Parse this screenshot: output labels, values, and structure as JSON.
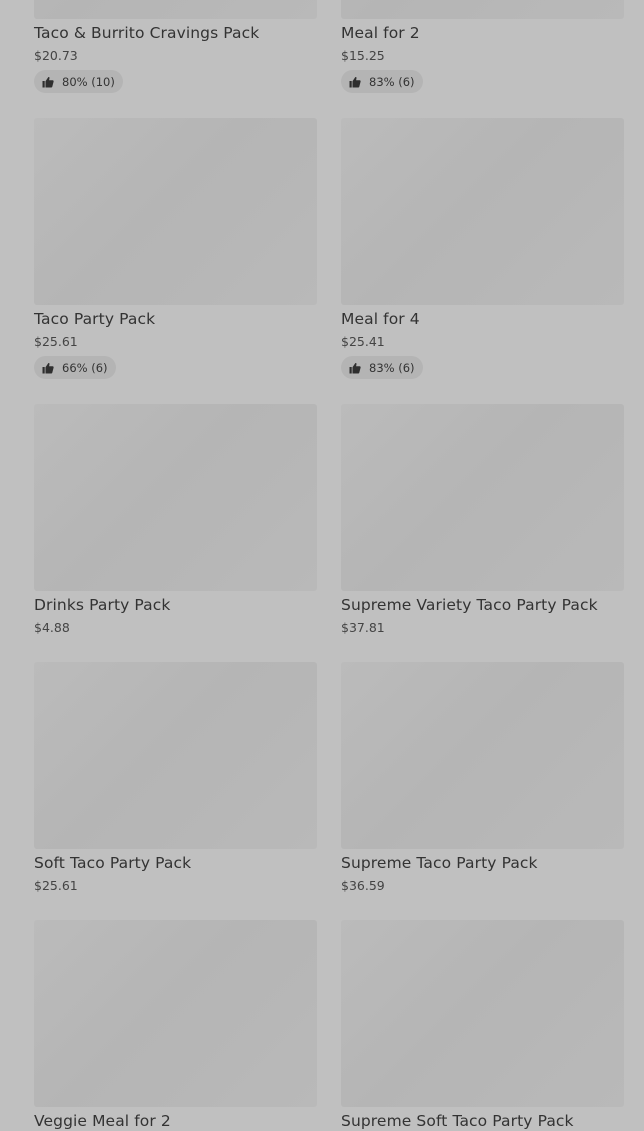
{
  "products": [
    {
      "name": "Taco & Burrito Cravings Pack",
      "price": "$20.73",
      "rating": "80% (10)"
    },
    {
      "name": "Meal for 2",
      "price": "$15.25",
      "rating": "83% (6)"
    },
    {
      "name": "Taco Party Pack",
      "price": "$25.61",
      "rating": "66% (6)"
    },
    {
      "name": "Meal for 4",
      "price": "$25.41",
      "rating": "83% (6)"
    },
    {
      "name": "Drinks Party Pack",
      "price": "$4.88",
      "rating": ""
    },
    {
      "name": "Supreme Variety Taco Party Pack",
      "price": "$37.81",
      "rating": ""
    },
    {
      "name": "Soft Taco Party Pack",
      "price": "$25.61",
      "rating": ""
    },
    {
      "name": "Supreme Taco Party Pack",
      "price": "$36.59",
      "rating": ""
    },
    {
      "name": "Veggie Meal for 2",
      "price": "",
      "rating": ""
    },
    {
      "name": "Supreme Soft Taco Party Pack",
      "price": "",
      "rating": ""
    }
  ],
  "icons": {
    "rating": "thumbs-up-icon"
  }
}
